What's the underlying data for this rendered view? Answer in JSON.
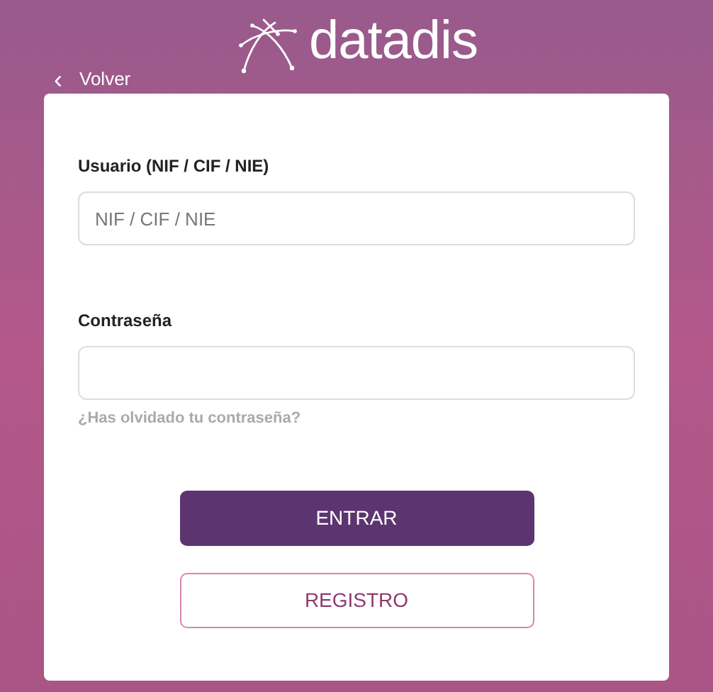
{
  "logo": {
    "text": "datadis"
  },
  "back_link": {
    "icon": "‹",
    "label": "Volver"
  },
  "form": {
    "fields": [
      {
        "label": "Usuario (NIF / CIF / NIE)",
        "placeholder": "NIF / CIF / NIE"
      },
      {
        "label": "Contraseña"
      }
    ],
    "forgot_link": "¿Has olvidado tu contraseña?",
    "buttons": [
      {
        "label": "ENTRAR",
        "kind": "primary"
      },
      {
        "label": "REGISTRO",
        "kind": "outline"
      }
    ]
  }
}
